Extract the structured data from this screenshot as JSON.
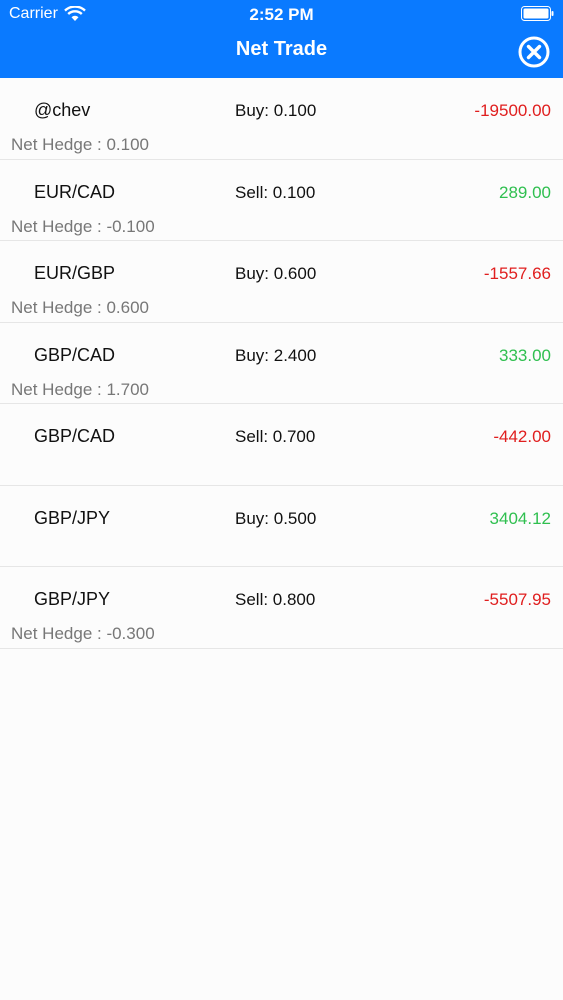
{
  "status_bar": {
    "carrier": "Carrier",
    "time": "2:52 PM"
  },
  "nav": {
    "title": "Net Trade",
    "close_icon": "close-circle-icon"
  },
  "colors": {
    "accent": "#0a7aff",
    "negative": "#e01e1e",
    "positive": "#2fbf4f"
  },
  "trades": [
    {
      "symbol": "@chev",
      "side": "Buy: 0.100",
      "pnl": "-19500.00",
      "pnl_sign": "neg",
      "hedge": "Net Hedge : 0.100"
    },
    {
      "symbol": "EUR/CAD",
      "side": "Sell: 0.100",
      "pnl": "289.00",
      "pnl_sign": "pos",
      "hedge": "Net Hedge : -0.100"
    },
    {
      "symbol": "EUR/GBP",
      "side": "Buy: 0.600",
      "pnl": "-1557.66",
      "pnl_sign": "neg",
      "hedge": "Net Hedge : 0.600"
    },
    {
      "symbol": "GBP/CAD",
      "side": "Buy: 2.400",
      "pnl": "333.00",
      "pnl_sign": "pos",
      "hedge": "Net Hedge : 1.700"
    },
    {
      "symbol": "GBP/CAD",
      "side": "Sell: 0.700",
      "pnl": "-442.00",
      "pnl_sign": "neg",
      "hedge": ""
    },
    {
      "symbol": "GBP/JPY",
      "side": "Buy: 0.500",
      "pnl": "3404.12",
      "pnl_sign": "pos",
      "hedge": ""
    },
    {
      "symbol": "GBP/JPY",
      "side": "Sell: 0.800",
      "pnl": "-5507.95",
      "pnl_sign": "neg",
      "hedge": "Net Hedge : -0.300"
    }
  ]
}
